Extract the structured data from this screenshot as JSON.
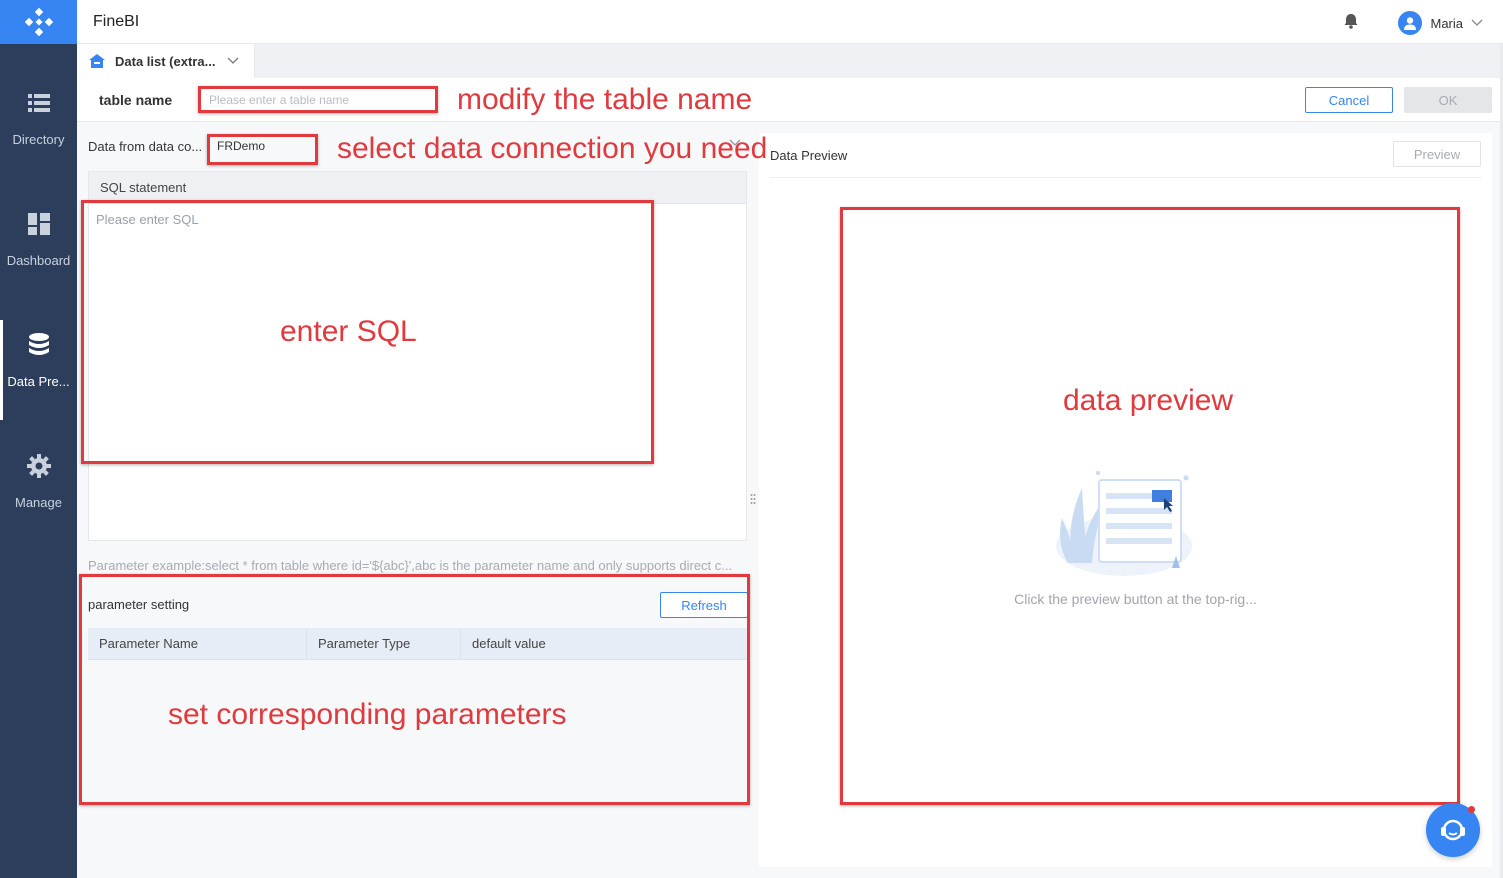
{
  "app": {
    "title": "FineBI"
  },
  "user": {
    "name": "Maria"
  },
  "sidebar": {
    "items": [
      {
        "label": "Directory",
        "icon": "list-icon"
      },
      {
        "label": "Dashboard",
        "icon": "dashboard-icon"
      },
      {
        "label": "Data Pre...",
        "icon": "database-icon",
        "active": true
      },
      {
        "label": "Manage",
        "icon": "gear-icon"
      }
    ]
  },
  "tab": {
    "label": "Data list (extra..."
  },
  "table_name": {
    "label": "table name",
    "placeholder": "Please enter a table name",
    "value": ""
  },
  "buttons": {
    "cancel": "Cancel",
    "ok": "OK",
    "preview": "Preview",
    "refresh": "Refresh"
  },
  "connection": {
    "label": "Data from data co...",
    "selected": "FRDemo"
  },
  "sql": {
    "header": "SQL statement",
    "placeholder": "Please enter SQL",
    "value": ""
  },
  "param_example": "Parameter example:select * from table where id='${abc}',abc is the parameter name and only supports direct c...",
  "parameters": {
    "title": "parameter setting",
    "columns": [
      "Parameter Name",
      "Parameter Type",
      "default value"
    ],
    "rows": []
  },
  "preview": {
    "title": "Data Preview",
    "empty_text": "Click the preview button at the top-rig..."
  },
  "annotations": {
    "color": "#e0393e",
    "table_name": "modify the table name",
    "connection": "select data connection you need",
    "sql": "enter SQL",
    "preview": "data preview",
    "parameters": "set corresponding parameters"
  },
  "colors": {
    "accent": "#3685f2",
    "sidebar": "#2c3e5c",
    "annotation": "#e0393e"
  }
}
